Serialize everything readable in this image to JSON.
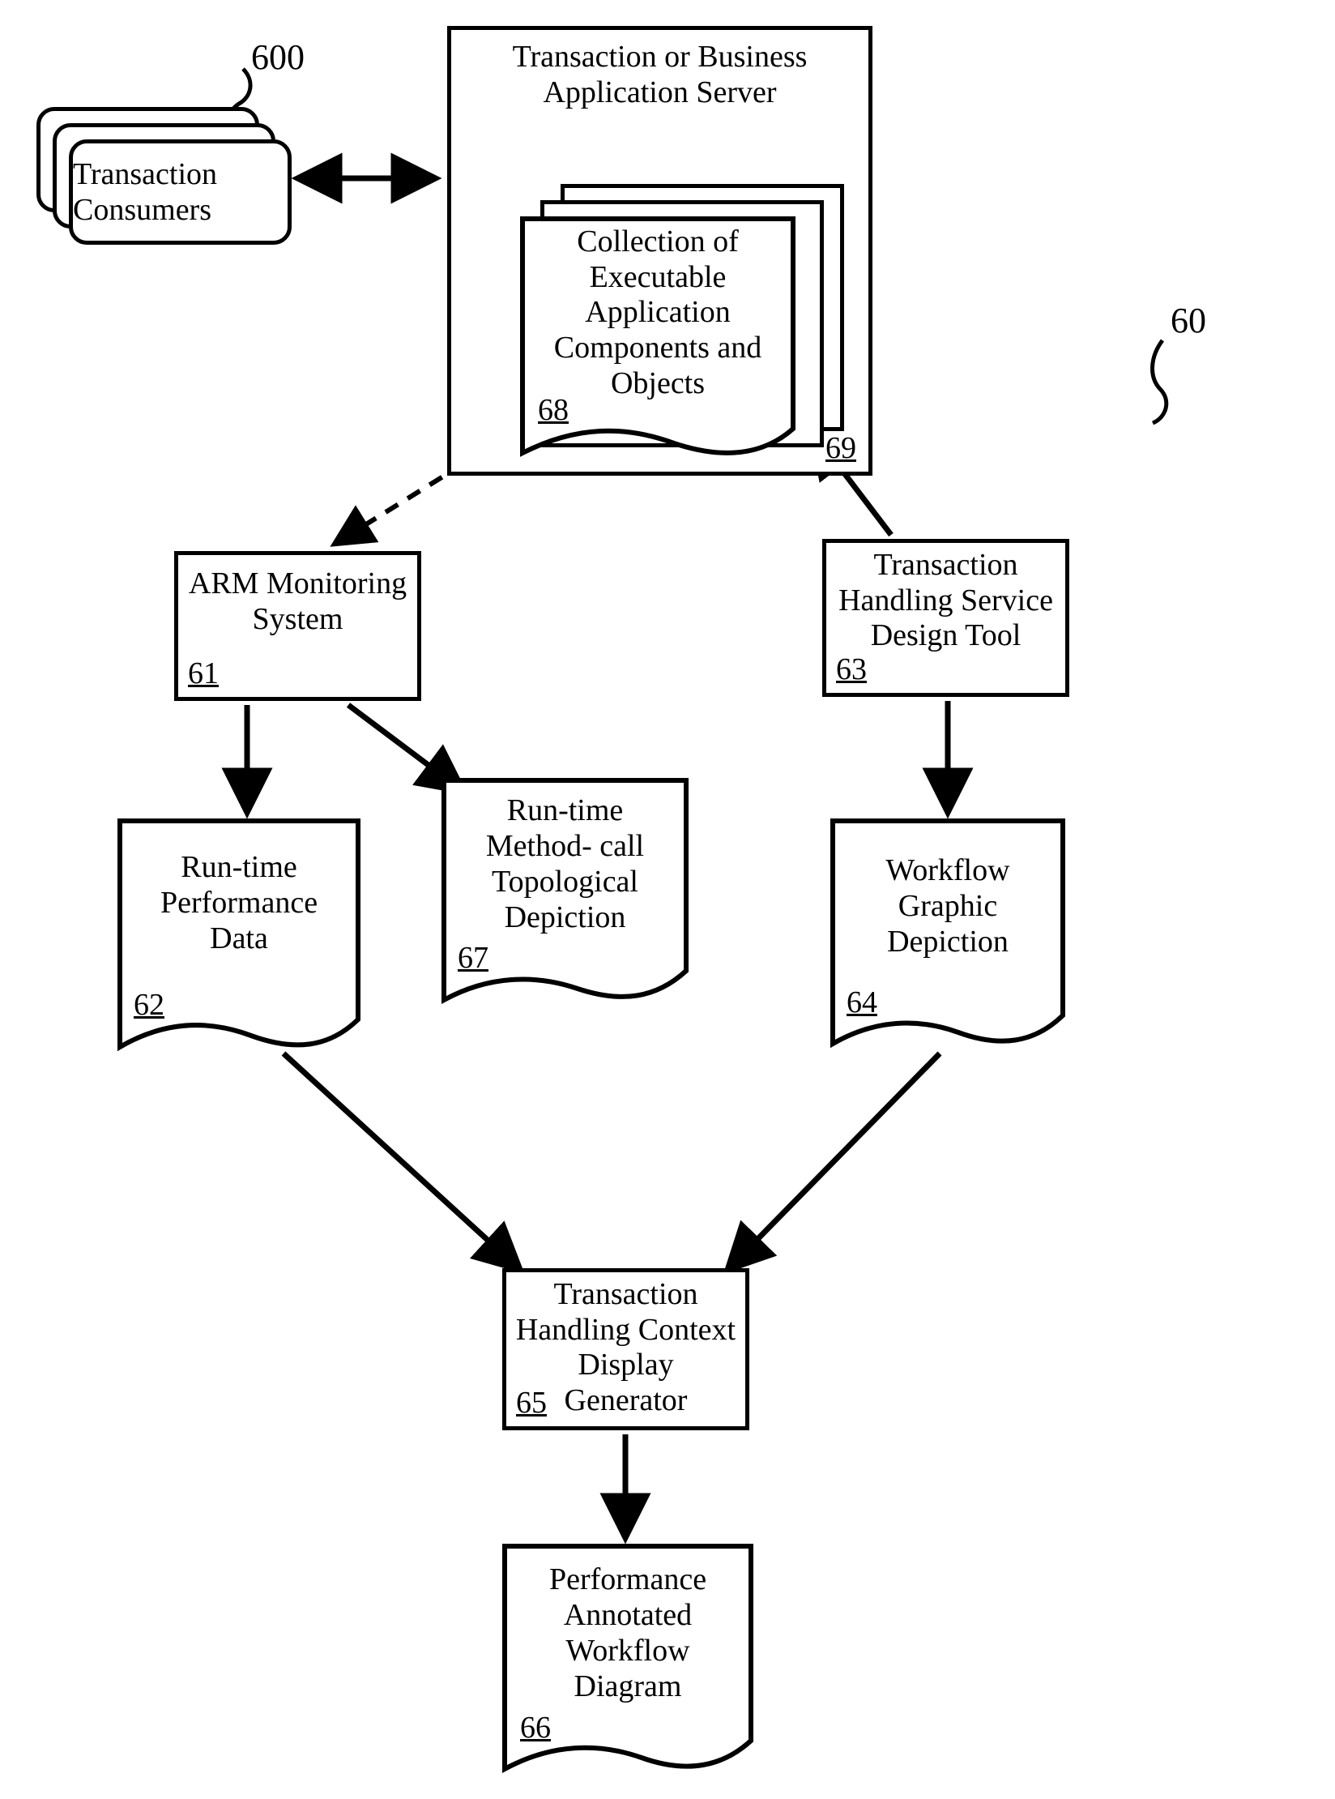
{
  "refs": {
    "system": "60",
    "consumers": "600",
    "arm": "61",
    "perfData": "62",
    "designTool": "63",
    "workflowGraphic": "64",
    "contextGen": "65",
    "annotatedWorkflow": "66",
    "methodCall": "67",
    "collection": "68",
    "server": "69"
  },
  "labels": {
    "consumers": "Transaction Consumers",
    "serverTitle": "Transaction or Business Application Server",
    "collection": "Collection of Executable Application Components and Objects",
    "arm": "ARM Monitoring System",
    "designTool": "Transaction Handling Service Design Tool",
    "perfData": "Run-time Performance Data",
    "methodCall": "Run-time Method- call Topological Depiction",
    "workflowGraphic": "Workflow Graphic Depiction",
    "contextGen": "Transaction Handling Context Display Generator",
    "annotatedWorkflow": "Performance Annotated Workflow Diagram"
  }
}
